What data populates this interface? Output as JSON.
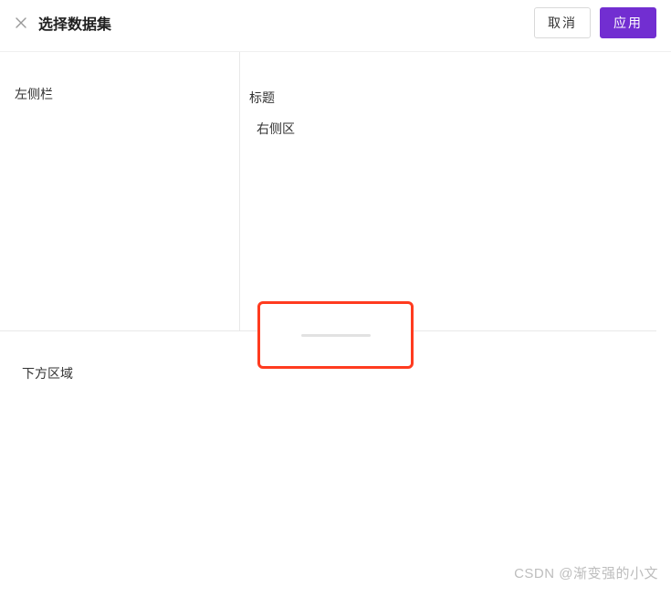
{
  "header": {
    "title": "选择数据集",
    "cancel_label": "取消",
    "apply_label": "应用"
  },
  "panels": {
    "left_label": "左侧栏",
    "right_title": "标题",
    "right_area_label": "右侧区",
    "bottom_label": "下方区域"
  },
  "watermark": "CSDN @渐变强的小文"
}
